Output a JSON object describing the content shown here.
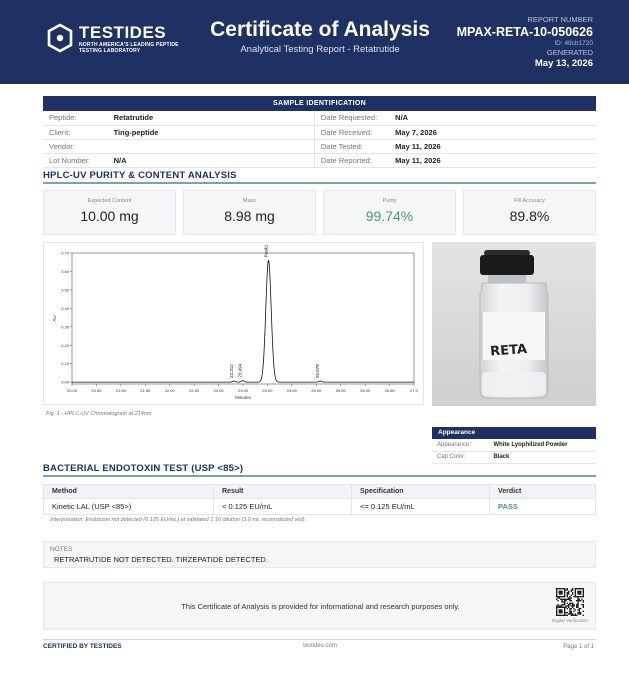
{
  "header": {
    "brand": "TESTIDES",
    "tagline": "NORTH AMERICA'S LEADING PEPTIDE TESTING LABORATORY",
    "title": "Certificate of Analysis",
    "subtitle": "Analytical Testing Report  -  Retatrutide",
    "report_number_label": "REPORT NUMBER",
    "report_number": "MPAX-RETA-10-050626",
    "report_id": "ID: 49cb1720",
    "generated_label": "GENERATED",
    "generated_date": "May 13, 2026"
  },
  "sample": {
    "section_title": "SAMPLE IDENTIFICATION",
    "rows": [
      {
        "l1": "Peptide:",
        "v1": "Retatrutide",
        "l2": "Date Requested:",
        "v2": "N/A"
      },
      {
        "l1": "Client:",
        "v1": "Ting-peptide",
        "l2": "Date Received:",
        "v2": "May 7, 2026"
      },
      {
        "l1": "Vendor:",
        "v1": "",
        "l2": "Date Tested:",
        "v2": "May 11, 2026"
      },
      {
        "l1": "Lot Number:",
        "v1": "N/A",
        "l2": "Date Reported:",
        "v2": "May 11, 2026"
      }
    ]
  },
  "hplc": {
    "section_title": "HPLC-UV PURITY & CONTENT ANALYSIS",
    "metrics": [
      {
        "label": "Expected Content",
        "value": "10.00 mg"
      },
      {
        "label": "Mass",
        "value": "8.98 mg"
      },
      {
        "label": "Purity",
        "value": "99.74%"
      },
      {
        "label": "Fill Accuracy",
        "value": "89.8%"
      }
    ],
    "figure_caption": "Fig. 1  -  HPLC-UV Chromatogram at 214nm"
  },
  "photo": {
    "vial_label": "RETA"
  },
  "appearance": {
    "title": "Appearance",
    "rows": [
      {
        "label": "Appearance:",
        "value": "White Lyophilized Powder"
      },
      {
        "label": "Cap Color:",
        "value": "Black"
      }
    ]
  },
  "endotoxin": {
    "section_title": "BACTERIAL ENDOTOXIN TEST (USP <85>)",
    "columns": [
      "Method",
      "Result",
      "Specification",
      "Verdict"
    ],
    "row": {
      "method": "Kinetic LAL (USP <85>)",
      "result": "< 0.125 EU/mL",
      "specification": "<= 0.125 EU/mL",
      "verdict": "PASS"
    },
    "interpretation": "Interpretation: Endotoxin not detected (0.125 EU/mL) at validated 1:16 dilution (3.0 mL reconstituted vial)."
  },
  "notes": {
    "label": "NOTES",
    "text": "RETRATRUTIDE NOT DETECTED. TIRZEPATIDE DETECTED."
  },
  "disclaimer": {
    "text": "This Certificate of Analysis is provided for informational and research purposes only.",
    "qr_label": "Digital Verification"
  },
  "footer": {
    "certified": "CERTIFIED BY TESTIDES",
    "website": "testides.com",
    "page": "Page 1 of 1"
  },
  "colors": {
    "navy": "#1f3163",
    "green": "#4d9a68",
    "teal_rule": "#7aa6a2"
  },
  "chart_data": {
    "type": "line",
    "title": "",
    "xlabel": "Minutes",
    "ylabel": "AU",
    "xlim": [
      20.0,
      27.0
    ],
    "ylim": [
      -0.01,
      0.7
    ],
    "x_ticks": [
      20.0,
      20.5,
      21.0,
      21.5,
      22.0,
      22.5,
      23.0,
      23.5,
      24.0,
      24.5,
      25.0,
      25.5,
      26.0,
      26.5,
      27.0
    ],
    "x_tick_labels": [
      "20.00",
      "20.50",
      "21.00",
      "21.50",
      "22.00",
      "22.50",
      "23.00",
      "23.50",
      "24.00",
      "24.50",
      "25.00",
      "25.50",
      "26.00",
      "26.50",
      "27.0"
    ],
    "y_ticks": [
      0.0,
      0.1,
      0.2,
      0.3,
      0.4,
      0.5,
      0.6,
      0.7
    ],
    "y_tick_labels": [
      "0.00",
      "0.10",
      "0.20",
      "0.30",
      "0.40",
      "0.50",
      "0.60",
      "0.70"
    ],
    "baseline": 0.0,
    "peaks": [
      {
        "rt": 23.312,
        "height": 0.006,
        "width": 0.03,
        "label": "23.312"
      },
      {
        "rt": 23.494,
        "height": 0.008,
        "width": 0.03,
        "label": "23.494"
      },
      {
        "rt": 24.022,
        "height": 0.66,
        "width": 0.055,
        "label": "Peak1 - 24.022"
      },
      {
        "rt": 25.078,
        "height": 0.006,
        "width": 0.03,
        "label": "25.078"
      }
    ]
  }
}
